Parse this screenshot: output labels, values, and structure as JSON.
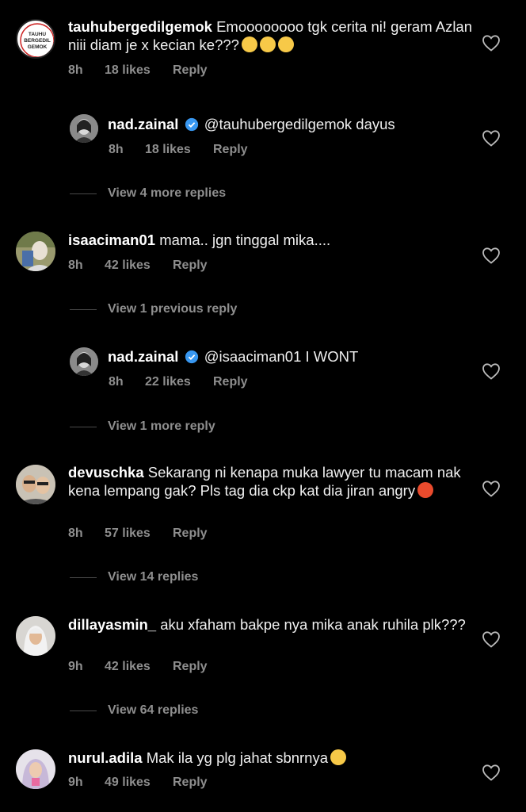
{
  "comments": [
    {
      "username": "tauhubergedilgemok",
      "text": "Emoooooooo tgk cerita ni! geram Azlan niii diam je x kecian ke???",
      "time": "8h",
      "likes": "18 likes",
      "reply": "Reply",
      "avatar_text": "TAUHU BERGEDIL GEMOK"
    },
    {
      "username": "nad.zainal",
      "text": "@tauhubergedilgemok dayus",
      "time": "8h",
      "likes": "18 likes",
      "reply": "Reply"
    },
    {
      "username": "isaaciman01",
      "text": "mama.. jgn tinggal mika....",
      "time": "8h",
      "likes": "42 likes",
      "reply": "Reply"
    },
    {
      "username": "nad.zainal",
      "text": "@isaaciman01 I WONT",
      "time": "8h",
      "likes": "22 likes",
      "reply": "Reply"
    },
    {
      "username": "devuschka",
      "text": "Sekarang ni kenapa muka lawyer tu macam nak kena lempang gak? Pls tag dia ckp kat dia jiran angry",
      "time": "8h",
      "likes": "57 likes",
      "reply": "Reply"
    },
    {
      "username": "dillayasmin_",
      "text": "aku xfaham bakpe nya mika anak ruhila plk???",
      "time": "9h",
      "likes": "42 likes",
      "reply": "Reply"
    },
    {
      "username": "nurul.adila",
      "text": "Mak ila yg plg jahat sbnrnya",
      "time": "9h",
      "likes": "49 likes",
      "reply": "Reply"
    }
  ],
  "view_more": [
    "View 4 more replies",
    "View 1 previous reply",
    "View 1 more reply",
    "View 14 replies",
    "View 64 replies"
  ],
  "icons": {
    "heart": "heart-outline-icon",
    "verified": "verified-badge-icon"
  },
  "colors": {
    "background": "#000000",
    "meta": "#8e8e8e",
    "verified": "#3897f0"
  }
}
